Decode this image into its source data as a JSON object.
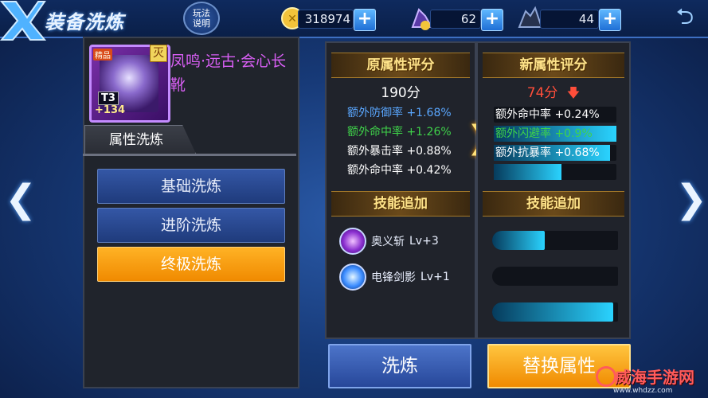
{
  "header": {
    "title": "装备洗炼",
    "help_label": "玩法说明",
    "gold": "318974",
    "gem_a": "62",
    "gem_b": "44"
  },
  "item": {
    "quality_tag": "精品",
    "tier": "T3",
    "level_bonus": "+134",
    "lock_glyph": "灭",
    "name": "凤鸣·远古·会心长靴",
    "name_color": "#d95ff5"
  },
  "left_tab": "属性洗炼",
  "wash_options": [
    {
      "label": "基础洗炼",
      "active": false
    },
    {
      "label": "进阶洗炼",
      "active": false
    },
    {
      "label": "终极洗炼",
      "active": true
    }
  ],
  "original": {
    "title": "原属性评分",
    "score": "190分",
    "stats": [
      {
        "name": "额外防御率",
        "value": "+1.68%",
        "color": "#5aa7ff"
      },
      {
        "name": "额外命中率",
        "value": "+1.26%",
        "color": "#3fd24a"
      },
      {
        "name": "额外暴击率",
        "value": "+0.88%",
        "color": "#ffffff"
      },
      {
        "name": "额外命中率",
        "value": "+0.42%",
        "color": "#ffffff"
      }
    ],
    "skills_title": "技能追加",
    "skills": [
      {
        "name": "奥义斩",
        "level": "Lv+3",
        "icon": "purple-orb-icon"
      },
      {
        "name": "电锋剑影",
        "level": "Lv+1",
        "icon": "blue-orb-icon"
      }
    ]
  },
  "new": {
    "title": "新属性评分",
    "score": "74分",
    "score_color": "#ff4e3a",
    "trend": "down",
    "stats": [
      {
        "name": "额外命中率",
        "value": "+0.24%",
        "color": "#ffffff",
        "fill": 0.0
      },
      {
        "name": "额外闪避率",
        "value": "+0.9%",
        "color": "#3fd24a",
        "fill": 1.0
      },
      {
        "name": "额外抗暴率",
        "value": "+0.68%",
        "color": "#ffffff",
        "fill": 0.95
      },
      {
        "name": "",
        "value": "",
        "color": "#ffffff",
        "fill": 0.55
      }
    ],
    "skills_title": "技能追加",
    "skill_bars": [
      0.42,
      0.0,
      0.96
    ]
  },
  "buttons": {
    "wash": "洗炼",
    "replace": "替换属性"
  },
  "watermark": {
    "text": "威海手游网",
    "sub": "www.whdzz.com"
  },
  "colors": {
    "active_orange": "#f08a00",
    "button_blue": "#1f3b7c",
    "gold_title": "#ffe48a"
  }
}
